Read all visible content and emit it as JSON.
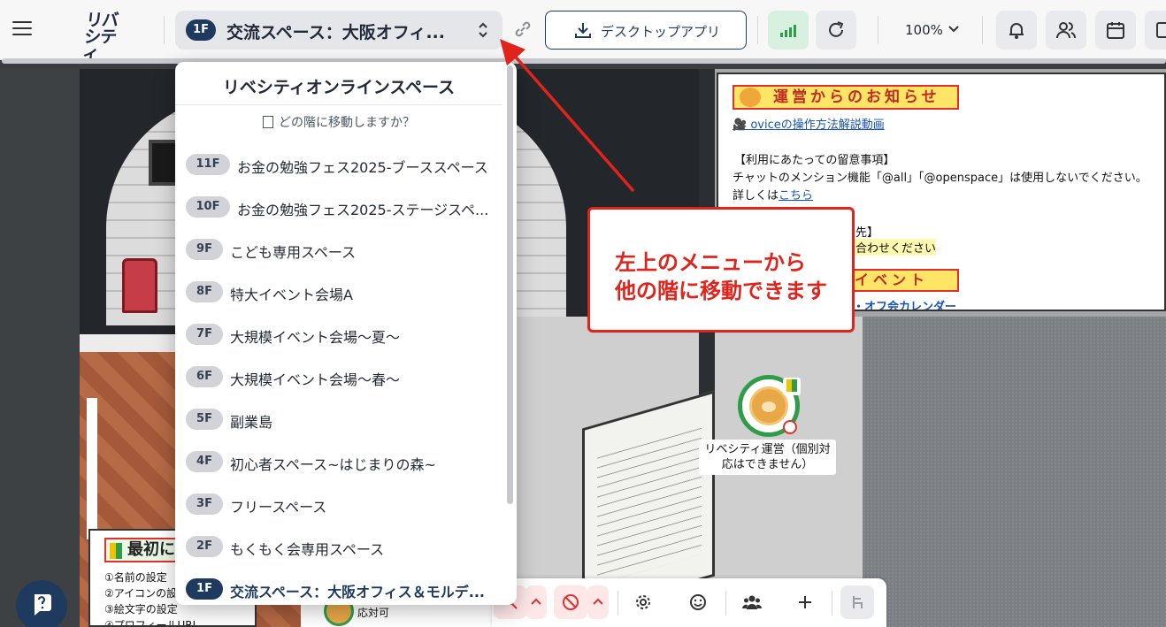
{
  "topbar": {
    "current_floor": {
      "badge": "1F",
      "name": "交流スペース：大阪オフィ..."
    },
    "desktop_app_label": "デスクトップアプリ",
    "zoom_label": "100%",
    "logo_line1": "リバ",
    "logo_line2": "シティ"
  },
  "dropdown": {
    "title": "リベシティオンラインスペース",
    "subtitle": "どの階に移動しますか？",
    "floors": [
      {
        "badge": "11F",
        "name": "お金の勉強フェス2025-ブーススペース",
        "active": false
      },
      {
        "badge": "10F",
        "name": "お金の勉強フェス2025-ステージスペ...",
        "active": false
      },
      {
        "badge": "9F",
        "name": "こども専用スペース",
        "active": false
      },
      {
        "badge": "8F",
        "name": "特大イベント会場A",
        "active": false
      },
      {
        "badge": "7F",
        "name": "大規模イベント会場～夏～",
        "active": false
      },
      {
        "badge": "6F",
        "name": "大規模イベント会場～春～",
        "active": false
      },
      {
        "badge": "5F",
        "name": "副業島",
        "active": false
      },
      {
        "badge": "4F",
        "name": "初心者スペース~はじまりの森~",
        "active": false
      },
      {
        "badge": "3F",
        "name": "フリースペース",
        "active": false
      },
      {
        "badge": "2F",
        "name": "もくもく会専用スペース",
        "active": false
      },
      {
        "badge": "1F",
        "name": "交流スペース：大阪オフィス＆モルデ...",
        "active": true
      }
    ]
  },
  "notice": {
    "banner": "運営からのお知らせ",
    "video_link": "🎥 oviceの操作方法解説動画",
    "caution_title": "【利用にあたっての留意事項】",
    "caution_text": "チャットのメンション機能「@all」「@openspace」は使用しないでください。",
    "detail_prefix": "詳しくは",
    "detail_link": "こちら",
    "contact_title": "せ先】",
    "contact_text": "い合わせください",
    "event_banner": "イベント",
    "calendar_link": "・オフ会カレンダー"
  },
  "avatar": {
    "label": "リベシティ運営（個別対応はできません）"
  },
  "guide": {
    "title": "最初に",
    "items": [
      "①名前の設定",
      "②アイコンの設",
      "③絵文字の設定",
      "④プロフィールURL"
    ]
  },
  "back_avatar": {
    "label": "応対可"
  },
  "callout": {
    "line1": "左上のメニューから",
    "line2": "他の階に移動できます"
  },
  "colors": {
    "navy": "#1e3a5f",
    "annotation_red": "#e0241b",
    "signal_green": "#2f9c4a"
  }
}
